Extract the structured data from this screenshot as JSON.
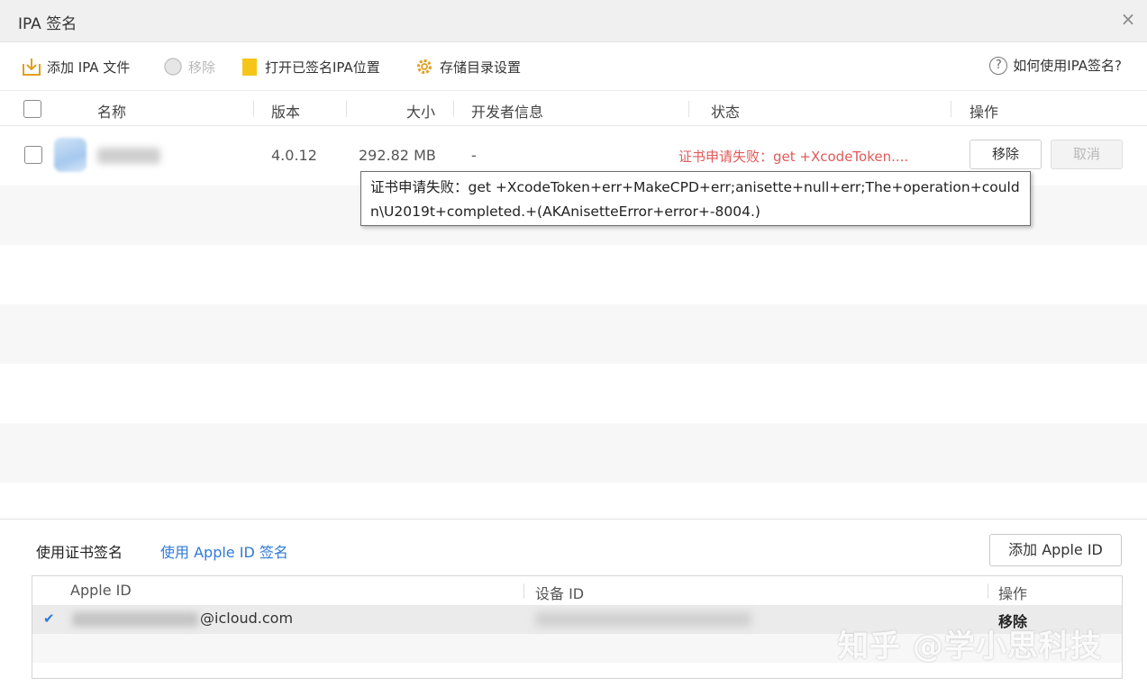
{
  "window": {
    "title": "IPA 签名",
    "close_glyph": "×"
  },
  "toolbar": {
    "add_ipa": "添加 IPA 文件",
    "remove": "移除",
    "open_signed": "打开已签名IPA位置",
    "storage_settings": "存储目录设置",
    "help": "如何使用IPA签名?",
    "help_glyph": "?"
  },
  "table": {
    "headers": {
      "name": "名称",
      "version": "版本",
      "size": "大小",
      "developer": "开发者信息",
      "status": "状态",
      "action": "操作"
    },
    "rows": [
      {
        "version": "4.0.12",
        "size": "292.82 MB",
        "developer": "-",
        "status": "证书申请失败：get +XcodeToken....",
        "remove_label": "移除",
        "cancel_label": "取消"
      }
    ]
  },
  "tooltip": {
    "text": "证书申请失败：get +XcodeToken+err+MakeCPD+err;anisette+null+err;The+operation+couldn\\U2019t+completed.+(AKAnisetteError+error+-8004.)"
  },
  "sign": {
    "tab_cert": "使用证书签名",
    "tab_appleid": "使用 Apple ID 签名",
    "add_apple_id": "添加 Apple ID",
    "headers": {
      "apple_id": "Apple ID",
      "device_id": "设备 ID",
      "action": "操作"
    },
    "accounts": [
      {
        "selected_glyph": "✔",
        "email_suffix": "@icloud.com",
        "remove_label": "移除"
      }
    ]
  },
  "watermark": "知乎 @学小思科技",
  "colors": {
    "error": "#e05a5a",
    "link": "#2f7bd8",
    "folder": "#f5c518",
    "gear": "#e0a020"
  }
}
